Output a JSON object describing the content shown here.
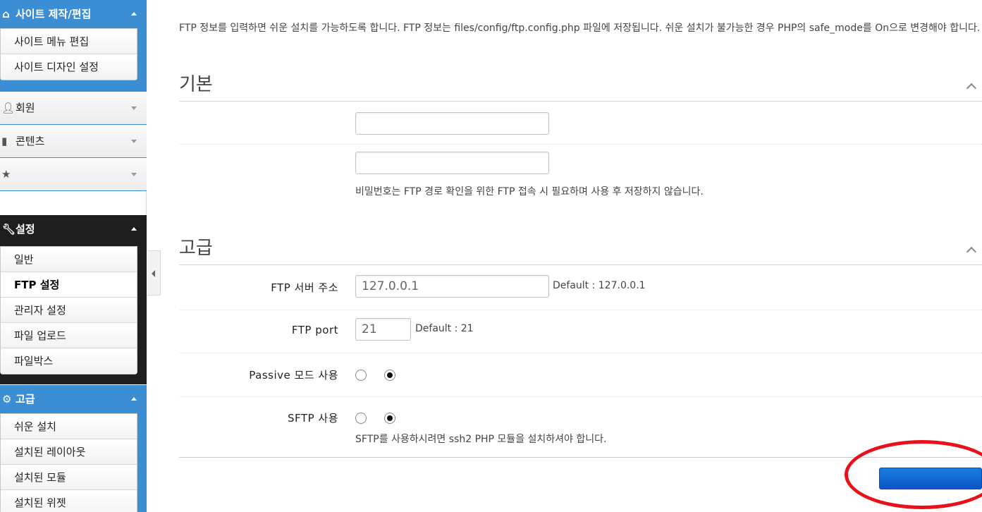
{
  "sidebar": {
    "site_group": {
      "title": "사이트 제작/편집",
      "icon": "home-icon",
      "items": [
        "사이트 메뉴 편집",
        "사이트 디자인 설정"
      ]
    },
    "member": {
      "label": "회원",
      "icon": "user-icon"
    },
    "contents": {
      "label": "콘텐츠",
      "icon": "book-icon"
    },
    "favorites": {
      "label": "",
      "icon": "star-icon"
    },
    "settings_group": {
      "title": "설정",
      "icon": "wrench-icon",
      "items": [
        "일반",
        "FTP 설정",
        "관리자 설정",
        "파일 업로드",
        "파일박스"
      ],
      "active_index": 1
    },
    "advanced_group": {
      "title": "고급",
      "icon": "gear-icon",
      "items": [
        "쉬운 설치",
        "설치된 레이아웃",
        "설치된 모듈",
        "설치된 위젯"
      ]
    }
  },
  "main": {
    "description": "FTP 정보를 입력하면 쉬운 설치를 가능하도록 합니다. FTP 정보는 files/config/ftp.config.php 파일에 저장됩니다. 쉬운 설치가 불가능한 경우 PHP의 safe_mode를 On으로 변경해야 합니다.",
    "basic_section": {
      "title": "기본",
      "username_value": "",
      "password_value": "",
      "password_hint": "비밀번호는 FTP 경로 확인을 위한 FTP 접속 시 필요하며 사용 후 저장하지 않습니다."
    },
    "advanced_section": {
      "title": "고급",
      "server_label": "FTP 서버 주소",
      "server_value": "127.0.0.1",
      "server_default": "Default : 127.0.0.1",
      "port_label": "FTP port",
      "port_value": "21",
      "port_default": "Default : 21",
      "passive_label": "Passive 모드 사용",
      "passive_selected": 1,
      "sftp_label": "SFTP 사용",
      "sftp_selected": 1,
      "sftp_hint": "SFTP를 사용하시려면 ssh2 PHP 모듈을 설치하셔야 합니다."
    },
    "save_button_label": ""
  },
  "colors": {
    "sidebar_blue": "#3b8ed3",
    "sidebar_dark": "#1e1e1e",
    "button_blue": "#0c56c9",
    "annotation_red": "#e8101b"
  }
}
